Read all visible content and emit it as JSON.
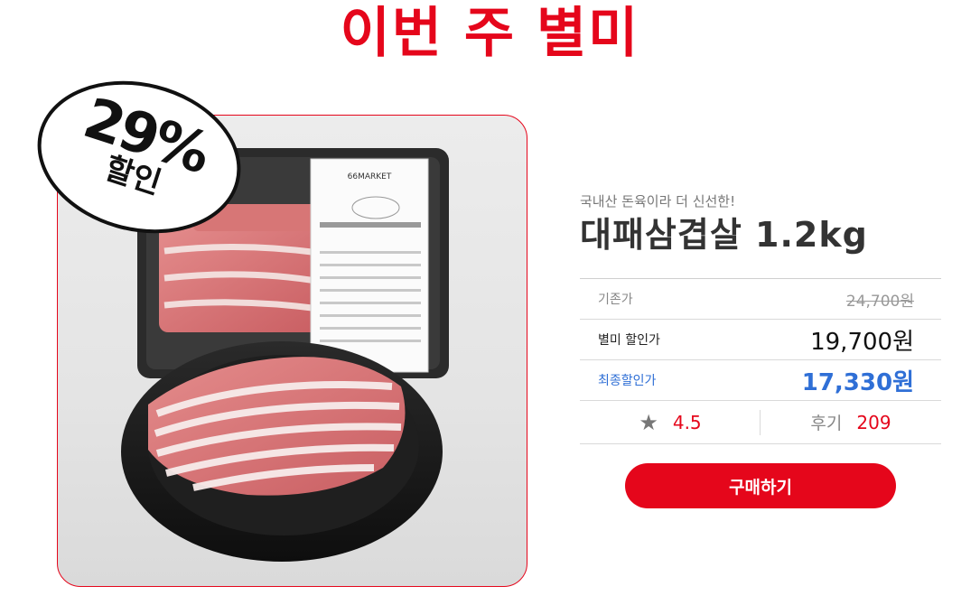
{
  "section": {
    "title": "이번 주 별미"
  },
  "badge": {
    "percent": "29%",
    "label": "할인"
  },
  "package": {
    "brand": "66MARKET"
  },
  "product": {
    "subtitle": "국내산 돈육이라 더 신선한!",
    "name": "대패삼겹살 1.2kg"
  },
  "prices": {
    "original_label": "기존가",
    "original_value": "24,700원",
    "sale_label": "별미 할인가",
    "sale_value": "19,700원",
    "final_label": "최종할인가",
    "final_value": "17,330원"
  },
  "rating": {
    "icon": "star-icon",
    "score": "4.5",
    "reviews_label": "후기",
    "reviews_count": "209"
  },
  "buy_button": {
    "label": "구매하기"
  },
  "colors": {
    "accent": "#e5061b",
    "final_price": "#2f6fd6"
  }
}
